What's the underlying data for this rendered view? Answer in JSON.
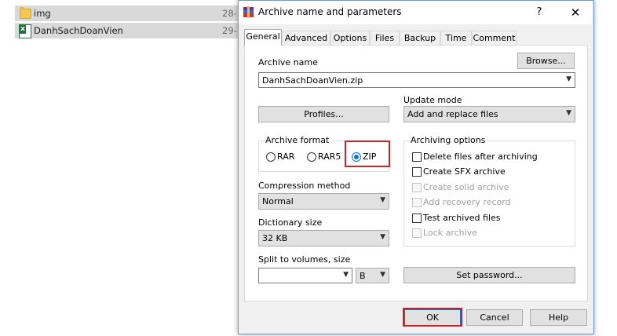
{
  "explorer": {
    "files": [
      {
        "name": "img",
        "date": "28-",
        "icon": "folder-icon"
      },
      {
        "name": "DanhSachDoanVien",
        "date": "29-",
        "icon": "excel-file-icon"
      }
    ]
  },
  "dialog": {
    "title": "Archive name and parameters",
    "help_label": "?",
    "close_label": "✕",
    "tabs": [
      "General",
      "Advanced",
      "Options",
      "Files",
      "Backup",
      "Time",
      "Comment"
    ],
    "active_tab": "General",
    "archive_name_label": "Archive name",
    "browse_label": "Browse...",
    "archive_name_value": "DanhSachDoanVien.zip",
    "profiles_label": "Profiles...",
    "update_mode_label": "Update mode",
    "update_mode_value": "Add and replace files",
    "archive_format": {
      "title": "Archive format",
      "options": [
        "RAR",
        "RAR5",
        "ZIP"
      ],
      "selected": "ZIP"
    },
    "compression_method_label": "Compression method",
    "compression_method_value": "Normal",
    "dictionary_size_label": "Dictionary size",
    "dictionary_size_value": "32 KB",
    "split_label": "Split to volumes, size",
    "split_value": "",
    "split_unit": "B",
    "archiving_options": {
      "title": "Archiving options",
      "items": [
        {
          "label": "Delete files after archiving",
          "enabled": true,
          "checked": false
        },
        {
          "label": "Create SFX archive",
          "enabled": true,
          "checked": false
        },
        {
          "label": "Create solid archive",
          "enabled": false,
          "checked": false
        },
        {
          "label": "Add recovery record",
          "enabled": false,
          "checked": false
        },
        {
          "label": "Test archived files",
          "enabled": true,
          "checked": false
        },
        {
          "label": "Lock archive",
          "enabled": false,
          "checked": false
        }
      ]
    },
    "set_password_label": "Set password...",
    "ok_label": "OK",
    "cancel_label": "Cancel",
    "help_button_label": "Help"
  },
  "colors": {
    "highlight": "#c8242b",
    "selected_radio": "#0078d7"
  }
}
